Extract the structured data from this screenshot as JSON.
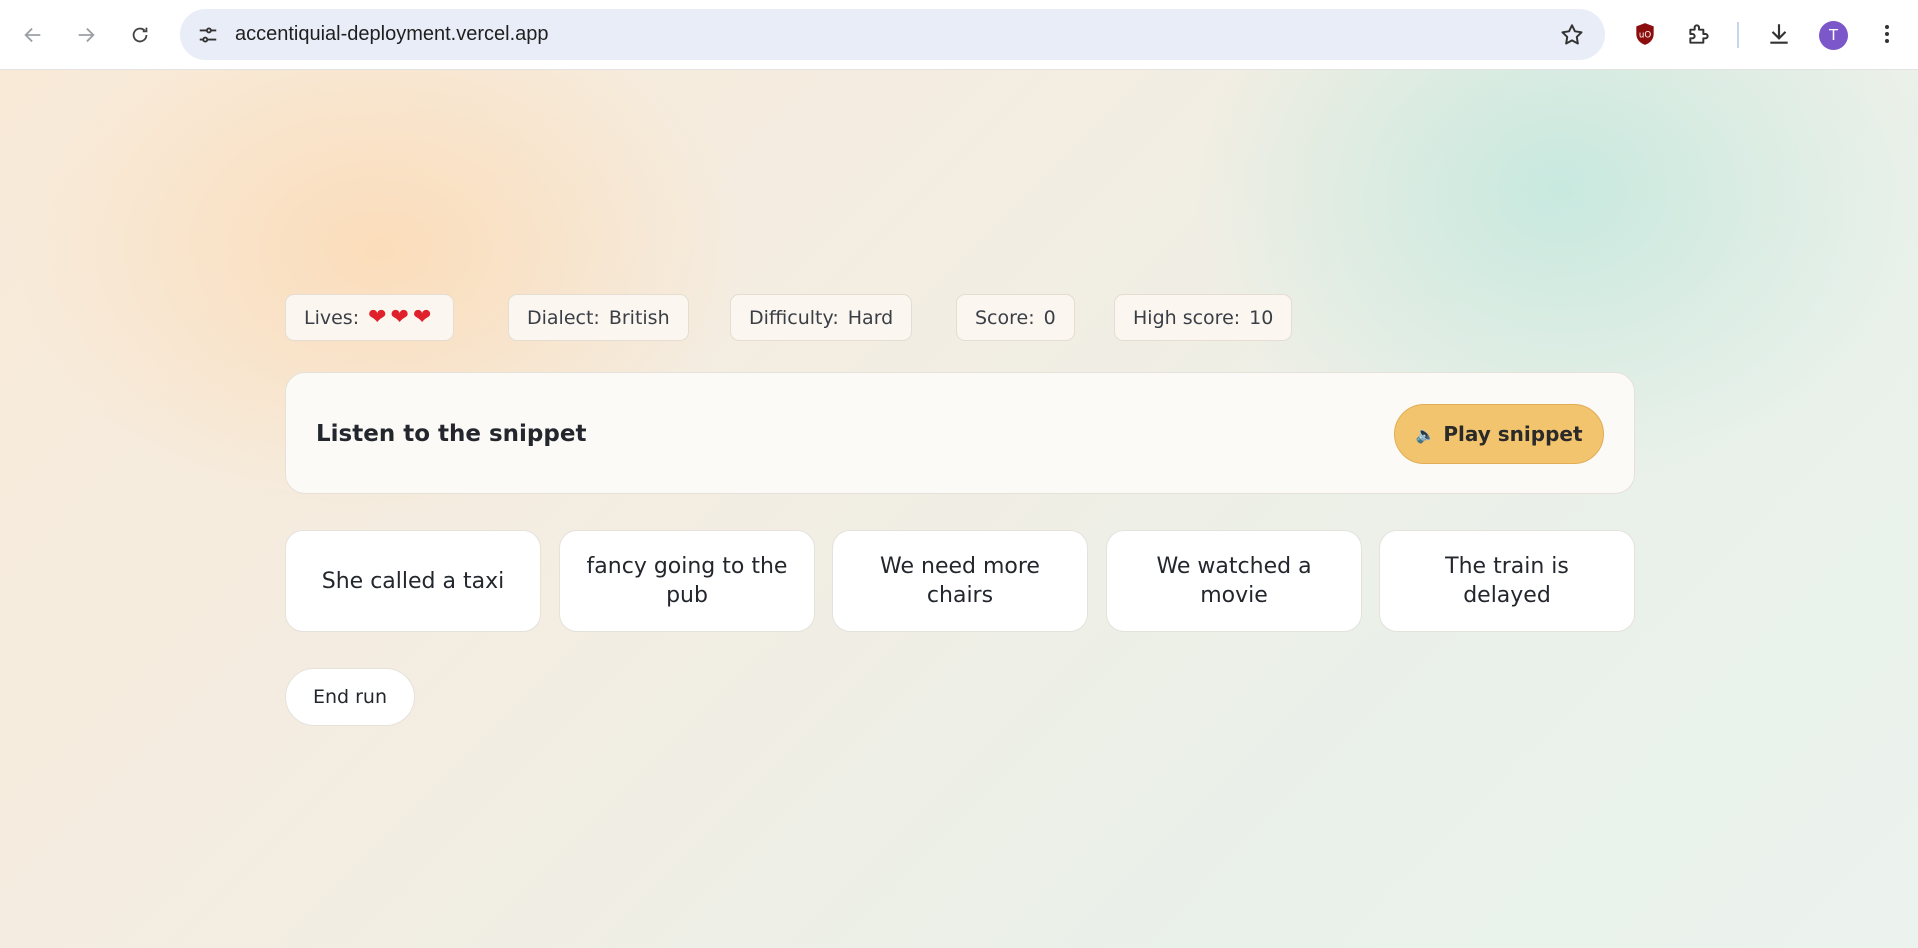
{
  "browser": {
    "url": "accentiquial-deployment.vercel.app",
    "avatar_letter": "T"
  },
  "stats": {
    "lives_label": "Lives:",
    "lives_count": 3,
    "dialect_label": "Dialect:",
    "dialect_value": "British",
    "difficulty_label": "Difficulty:",
    "difficulty_value": "Hard",
    "score_label": "Score:",
    "score_value": "0",
    "high_score_label": "High score:",
    "high_score_value": "10"
  },
  "prompt": {
    "title": "Listen to the snippet",
    "play_label": "Play snippet"
  },
  "answers": [
    "She called a taxi",
    "fancy going to the pub",
    "We need more chairs",
    "We watched a movie",
    "The train is delayed"
  ],
  "end_run_label": "End run",
  "colors": {
    "play_button": "#f3c46e",
    "heart": "#e0202a"
  }
}
